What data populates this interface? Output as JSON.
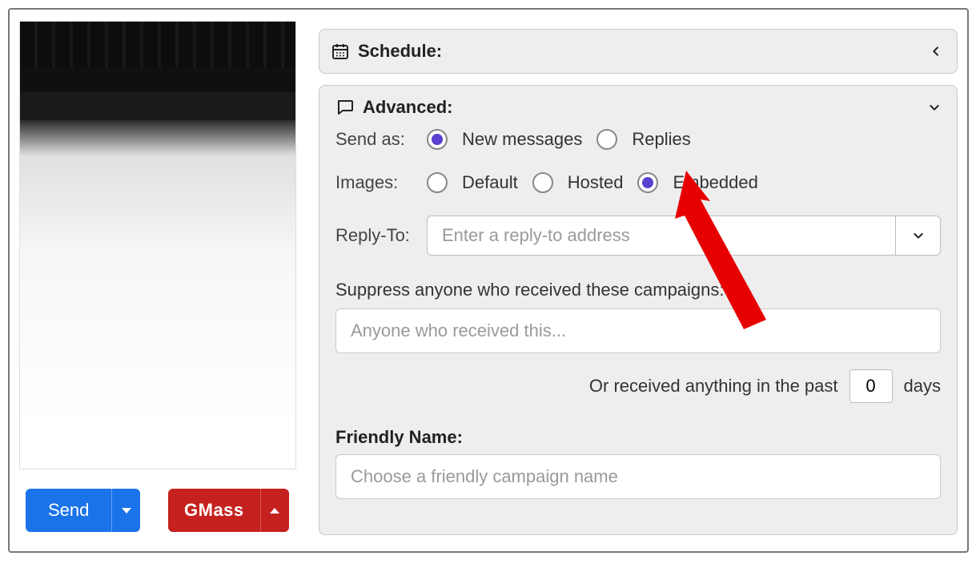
{
  "buttons": {
    "send": "Send",
    "gmass": "GMass"
  },
  "schedule": {
    "title": "Schedule:"
  },
  "advanced": {
    "title": "Advanced:",
    "send_as": {
      "label": "Send as:",
      "options": {
        "new_messages": "New messages",
        "replies": "Replies"
      },
      "selected": "new_messages"
    },
    "images": {
      "label": "Images:",
      "options": {
        "default": "Default",
        "hosted": "Hosted",
        "embedded": "Embedded"
      },
      "selected": "embedded"
    },
    "reply_to": {
      "label": "Reply-To:",
      "placeholder": "Enter a reply-to address",
      "value": ""
    },
    "suppress": {
      "label": "Suppress anyone who received these campaigns:",
      "placeholder": "Anyone who received this...",
      "value": ""
    },
    "past": {
      "prefix": "Or received anything in the past",
      "value": "0",
      "suffix": "days"
    },
    "friendly_name": {
      "label": "Friendly Name:",
      "placeholder": "Choose a friendly campaign name",
      "value": ""
    }
  }
}
